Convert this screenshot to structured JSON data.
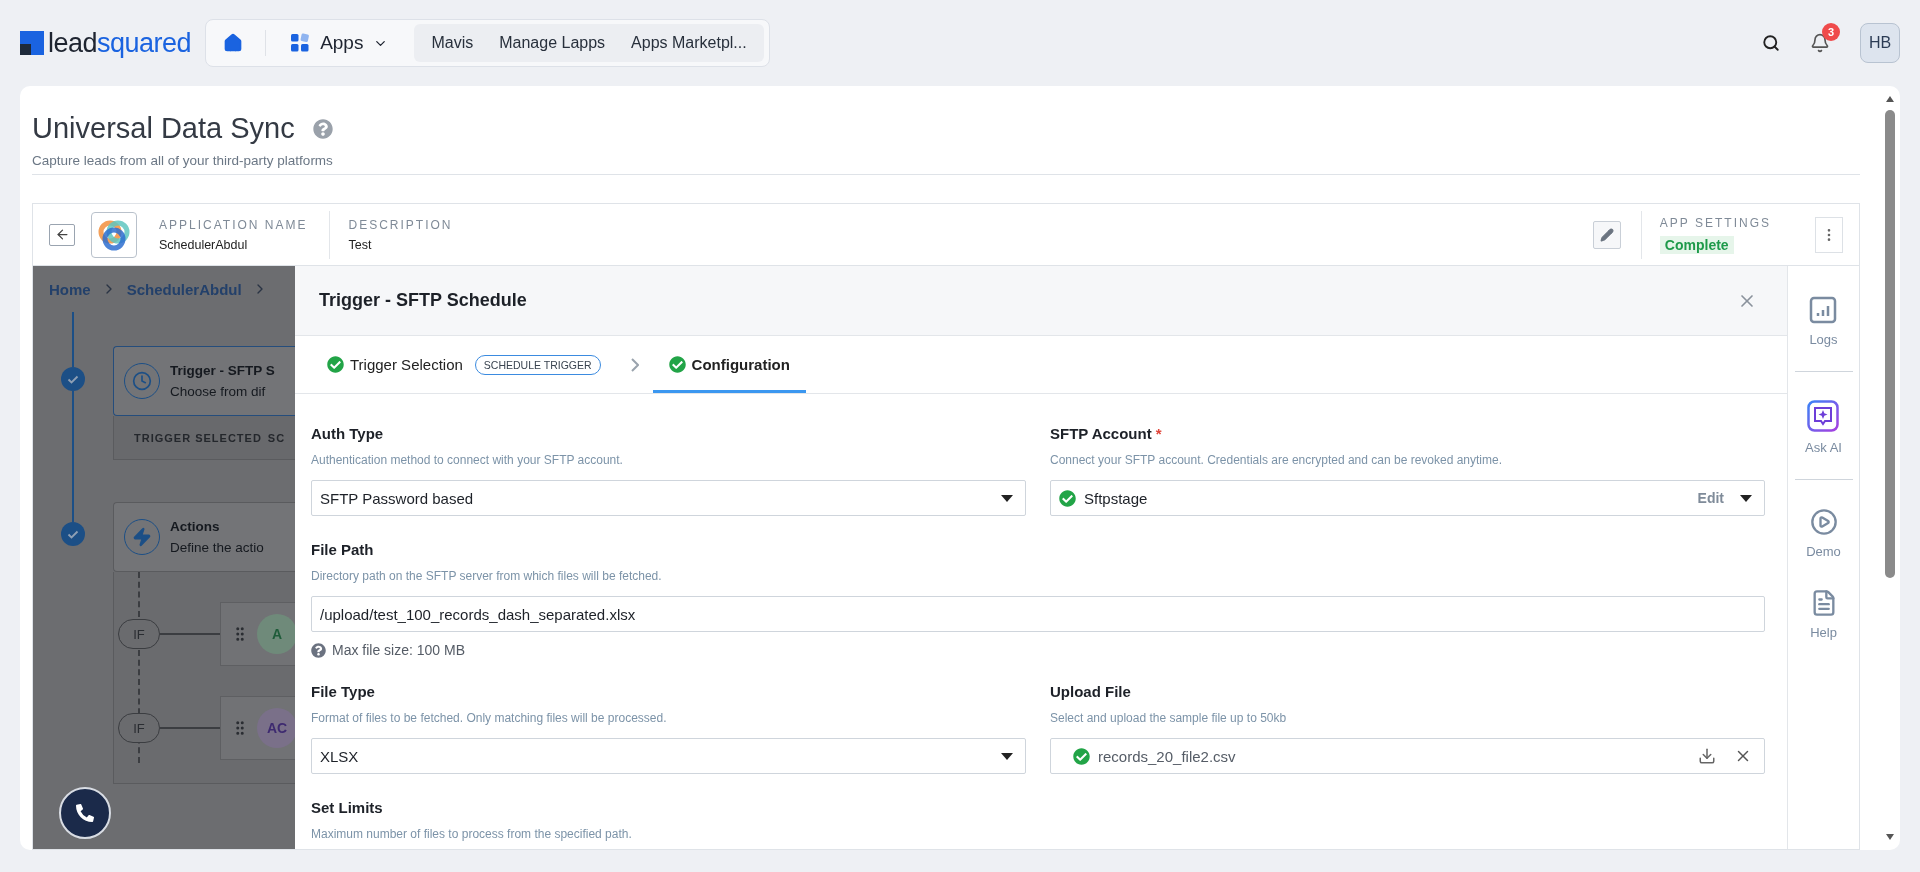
{
  "top_nav": {
    "logo": {
      "part_1": "lead",
      "part_2": "squared"
    },
    "apps_menu": "Apps",
    "links": [
      "Mavis",
      "Manage Lapps",
      "Apps Marketpl..."
    ],
    "notification_count": "3",
    "avatar_initials": "HB"
  },
  "page": {
    "title": "Universal Data Sync",
    "subtitle": "Capture leads from all of your third-party platforms"
  },
  "app_header": {
    "application_name_label": "APPLICATION NAME",
    "application_name": "SchedulerAbdul",
    "description_label": "DESCRIPTION",
    "description": "Test",
    "app_settings_label": "APP SETTINGS",
    "app_settings_status": "Complete"
  },
  "background_flow": {
    "breadcrumb": [
      "Home",
      "SchedulerAbdul"
    ],
    "trigger_step": {
      "title": "Trigger - SFTP S",
      "subtitle": "Choose from dif",
      "footer_label": "TRIGGER SELECTED",
      "footer_value": "SC"
    },
    "actions_step": {
      "title": "Actions",
      "subtitle": "Define the actio",
      "branches": [
        {
          "condition": "IF",
          "badge": "A"
        },
        {
          "condition": "IF",
          "badge": "AC"
        }
      ]
    }
  },
  "modal": {
    "title": "Trigger - SFTP Schedule",
    "steps": [
      {
        "label": "Trigger Selection",
        "tag": "SCHEDULE TRIGGER",
        "completed": true,
        "selected": false
      },
      {
        "label": "Configuration",
        "completed": true,
        "selected": true
      }
    ],
    "fields": [
      {
        "kind": "select",
        "label": "Auth Type",
        "hint": "Authentication method to connect with your SFTP account.",
        "value": "SFTP Password based"
      },
      {
        "kind": "account",
        "label": "SFTP Account",
        "required_mark": "*",
        "hint": "Connect your SFTP account. Credentials are encrypted and can be revoked anytime.",
        "value": "Sftpstage",
        "connected": true,
        "action": "Edit"
      },
      {
        "kind": "path",
        "label": "File Path",
        "hint": "Directory path on the SFTP server from which files will be fetched.",
        "value": "/upload/test_100_records_dash_separated.xlsx",
        "note": "Max file size: 100 MB"
      },
      {
        "kind": "select",
        "label": "File Type",
        "hint": "Format of files to be fetched. Only matching files will be processed.",
        "value": "XLSX"
      },
      {
        "kind": "file",
        "label": "Upload File",
        "hint": "Select and upload the sample file up to 50kb",
        "value": "records_20_file2.csv",
        "uploaded": true
      },
      {
        "kind": "input",
        "label": "Set Limits",
        "hint": "Maximum number of files to process from the specified path."
      }
    ]
  },
  "side_rail": [
    {
      "kind": "logs",
      "label": "Logs"
    },
    {
      "kind": "ai",
      "label": "Ask AI"
    },
    {
      "kind": "demo",
      "label": "Demo"
    },
    {
      "kind": "help",
      "label": "Help"
    }
  ]
}
